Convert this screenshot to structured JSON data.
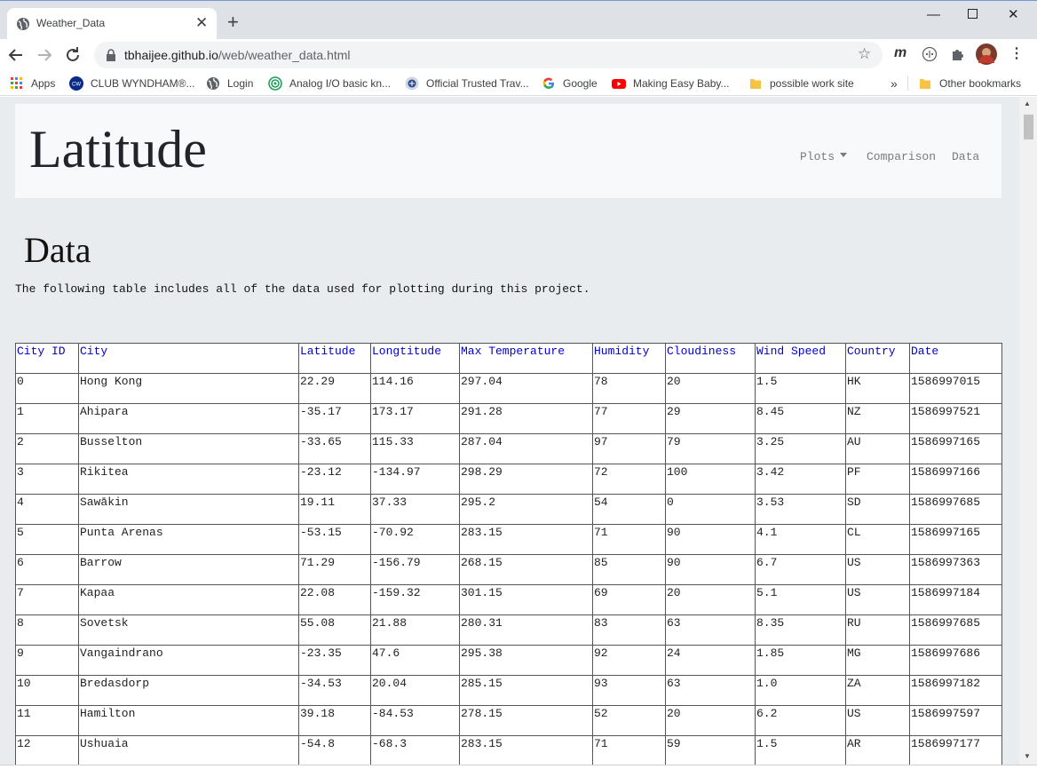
{
  "browser": {
    "tab_title": "Weather_Data",
    "url_host": "tbhaijee.github.io",
    "url_path": "/web/weather_data.html",
    "accent_color": "#1a73e8",
    "bookmarks": [
      "Apps",
      "CLUB WYNDHAM®...",
      "Login",
      "Analog I/O basic kn...",
      "Official Trusted Trav...",
      "Google",
      "Making Easy Baby...",
      "possible work site",
      "Other bookmarks"
    ],
    "bookmark_overflow": "»"
  },
  "site": {
    "brand": "Latitude",
    "nav": [
      "Plots",
      "Comparison",
      "Data"
    ]
  },
  "page": {
    "title": "Data",
    "intro": "The following table includes all of the data used for plotting during this project."
  },
  "table": {
    "headers": [
      "City ID",
      "City",
      "Latitude",
      "Longtitude",
      "Max Temperature",
      "Humidity",
      "Cloudiness",
      "Wind Speed",
      "Country",
      "Date"
    ],
    "rows": [
      [
        "0",
        "Hong Kong",
        "22.29",
        "114.16",
        "297.04",
        "78",
        "20",
        "1.5",
        "HK",
        "1586997015"
      ],
      [
        "1",
        "Ahipara",
        "-35.17",
        "173.17",
        "291.28",
        "77",
        "29",
        "8.45",
        "NZ",
        "1586997521"
      ],
      [
        "2",
        "Busselton",
        "-33.65",
        "115.33",
        "287.04",
        "97",
        "79",
        "3.25",
        "AU",
        "1586997165"
      ],
      [
        "3",
        "Rikitea",
        "-23.12",
        "-134.97",
        "298.29",
        "72",
        "100",
        "3.42",
        "PF",
        "1586997166"
      ],
      [
        "4",
        "Sawākin",
        "19.11",
        "37.33",
        "295.2",
        "54",
        "0",
        "3.53",
        "SD",
        "1586997685"
      ],
      [
        "5",
        "Punta Arenas",
        "-53.15",
        "-70.92",
        "283.15",
        "71",
        "90",
        "4.1",
        "CL",
        "1586997165"
      ],
      [
        "6",
        "Barrow",
        "71.29",
        "-156.79",
        "268.15",
        "85",
        "90",
        "6.7",
        "US",
        "1586997363"
      ],
      [
        "7",
        "Kapaa",
        "22.08",
        "-159.32",
        "301.15",
        "69",
        "20",
        "5.1",
        "US",
        "1586997184"
      ],
      [
        "8",
        "Sovetsk",
        "55.08",
        "21.88",
        "280.31",
        "83",
        "63",
        "8.35",
        "RU",
        "1586997685"
      ],
      [
        "9",
        "Vangaindrano",
        "-23.35",
        "47.6",
        "295.38",
        "92",
        "24",
        "1.85",
        "MG",
        "1586997686"
      ],
      [
        "10",
        "Bredasdorp",
        "-34.53",
        "20.04",
        "285.15",
        "93",
        "63",
        "1.0",
        "ZA",
        "1586997182"
      ],
      [
        "11",
        "Hamilton",
        "39.18",
        "-84.53",
        "278.15",
        "52",
        "20",
        "6.2",
        "US",
        "1586997597"
      ],
      [
        "12",
        "Ushuaia",
        "-54.8",
        "-68.3",
        "283.15",
        "71",
        "59",
        "1.5",
        "AR",
        "1586997177"
      ]
    ]
  }
}
